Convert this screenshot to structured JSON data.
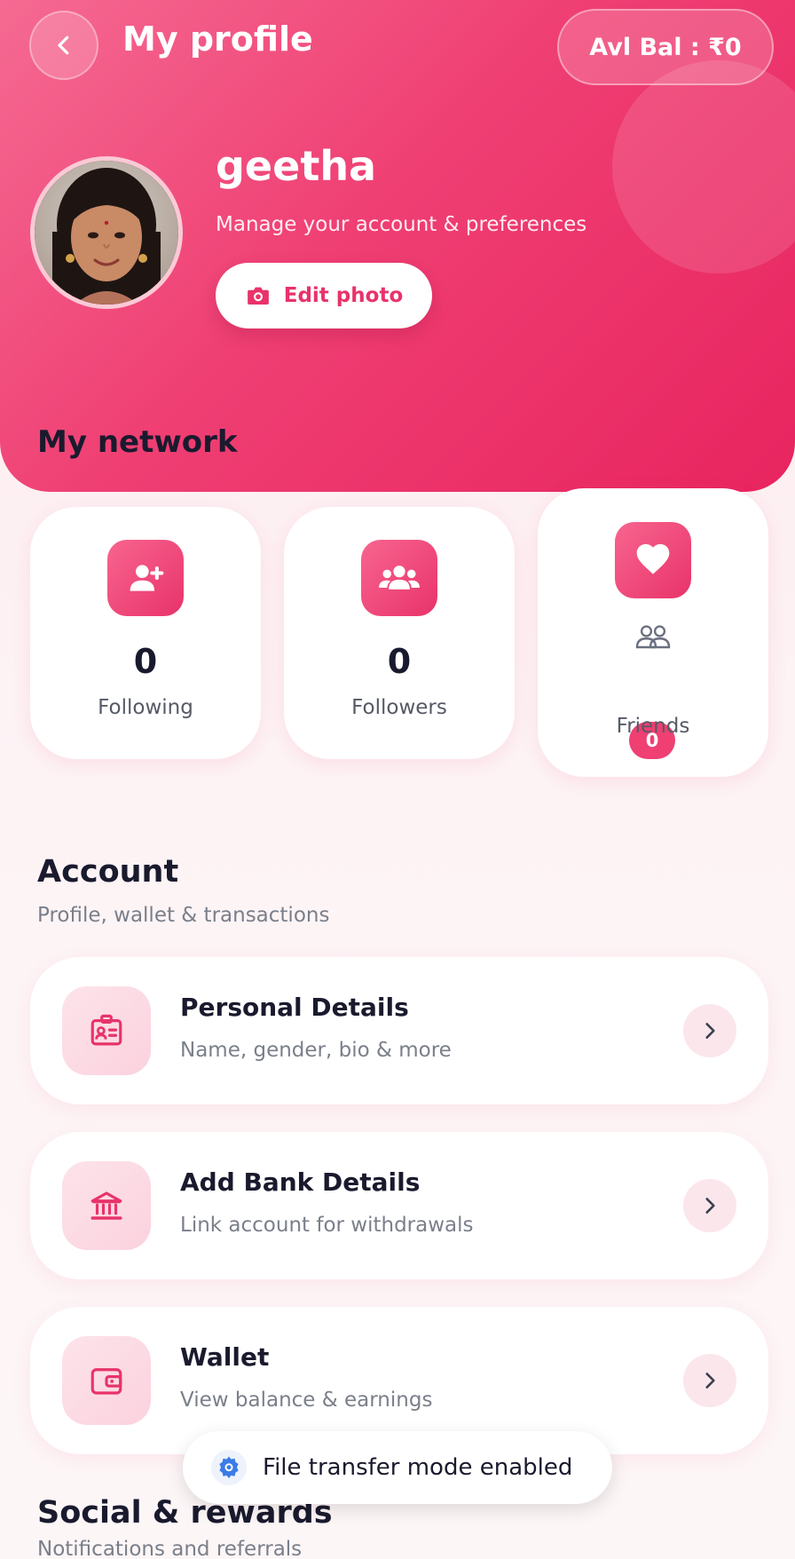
{
  "header": {
    "title": "My profile",
    "balance_label": "Avl Bal : ₹0"
  },
  "profile": {
    "name": "geetha",
    "subtitle": "Manage your account & preferences",
    "edit_photo_label": "Edit photo"
  },
  "network": {
    "title": "My network",
    "following": {
      "count": "0",
      "label": "Following"
    },
    "followers": {
      "count": "0",
      "label": "Followers"
    },
    "friends": {
      "count": "0",
      "label": "Friends"
    }
  },
  "account": {
    "title": "Account",
    "subtitle": "Profile, wallet & transactions",
    "items": [
      {
        "title": "Personal Details",
        "subtitle": "Name, gender, bio & more",
        "icon": "id-card-icon"
      },
      {
        "title": "Add Bank Details",
        "subtitle": "Link account for withdrawals",
        "icon": "bank-icon"
      },
      {
        "title": "Wallet",
        "subtitle": "View balance & earnings",
        "icon": "wallet-icon"
      }
    ]
  },
  "social": {
    "title": "Social & rewards",
    "subtitle": "Notifications and referrals"
  },
  "toast": {
    "message": "File transfer mode enabled"
  },
  "colors": {
    "accent": "#ef3f73",
    "accent_dark": "#e8245f",
    "text": "#1a1a2e",
    "muted": "#7a7f8a"
  }
}
